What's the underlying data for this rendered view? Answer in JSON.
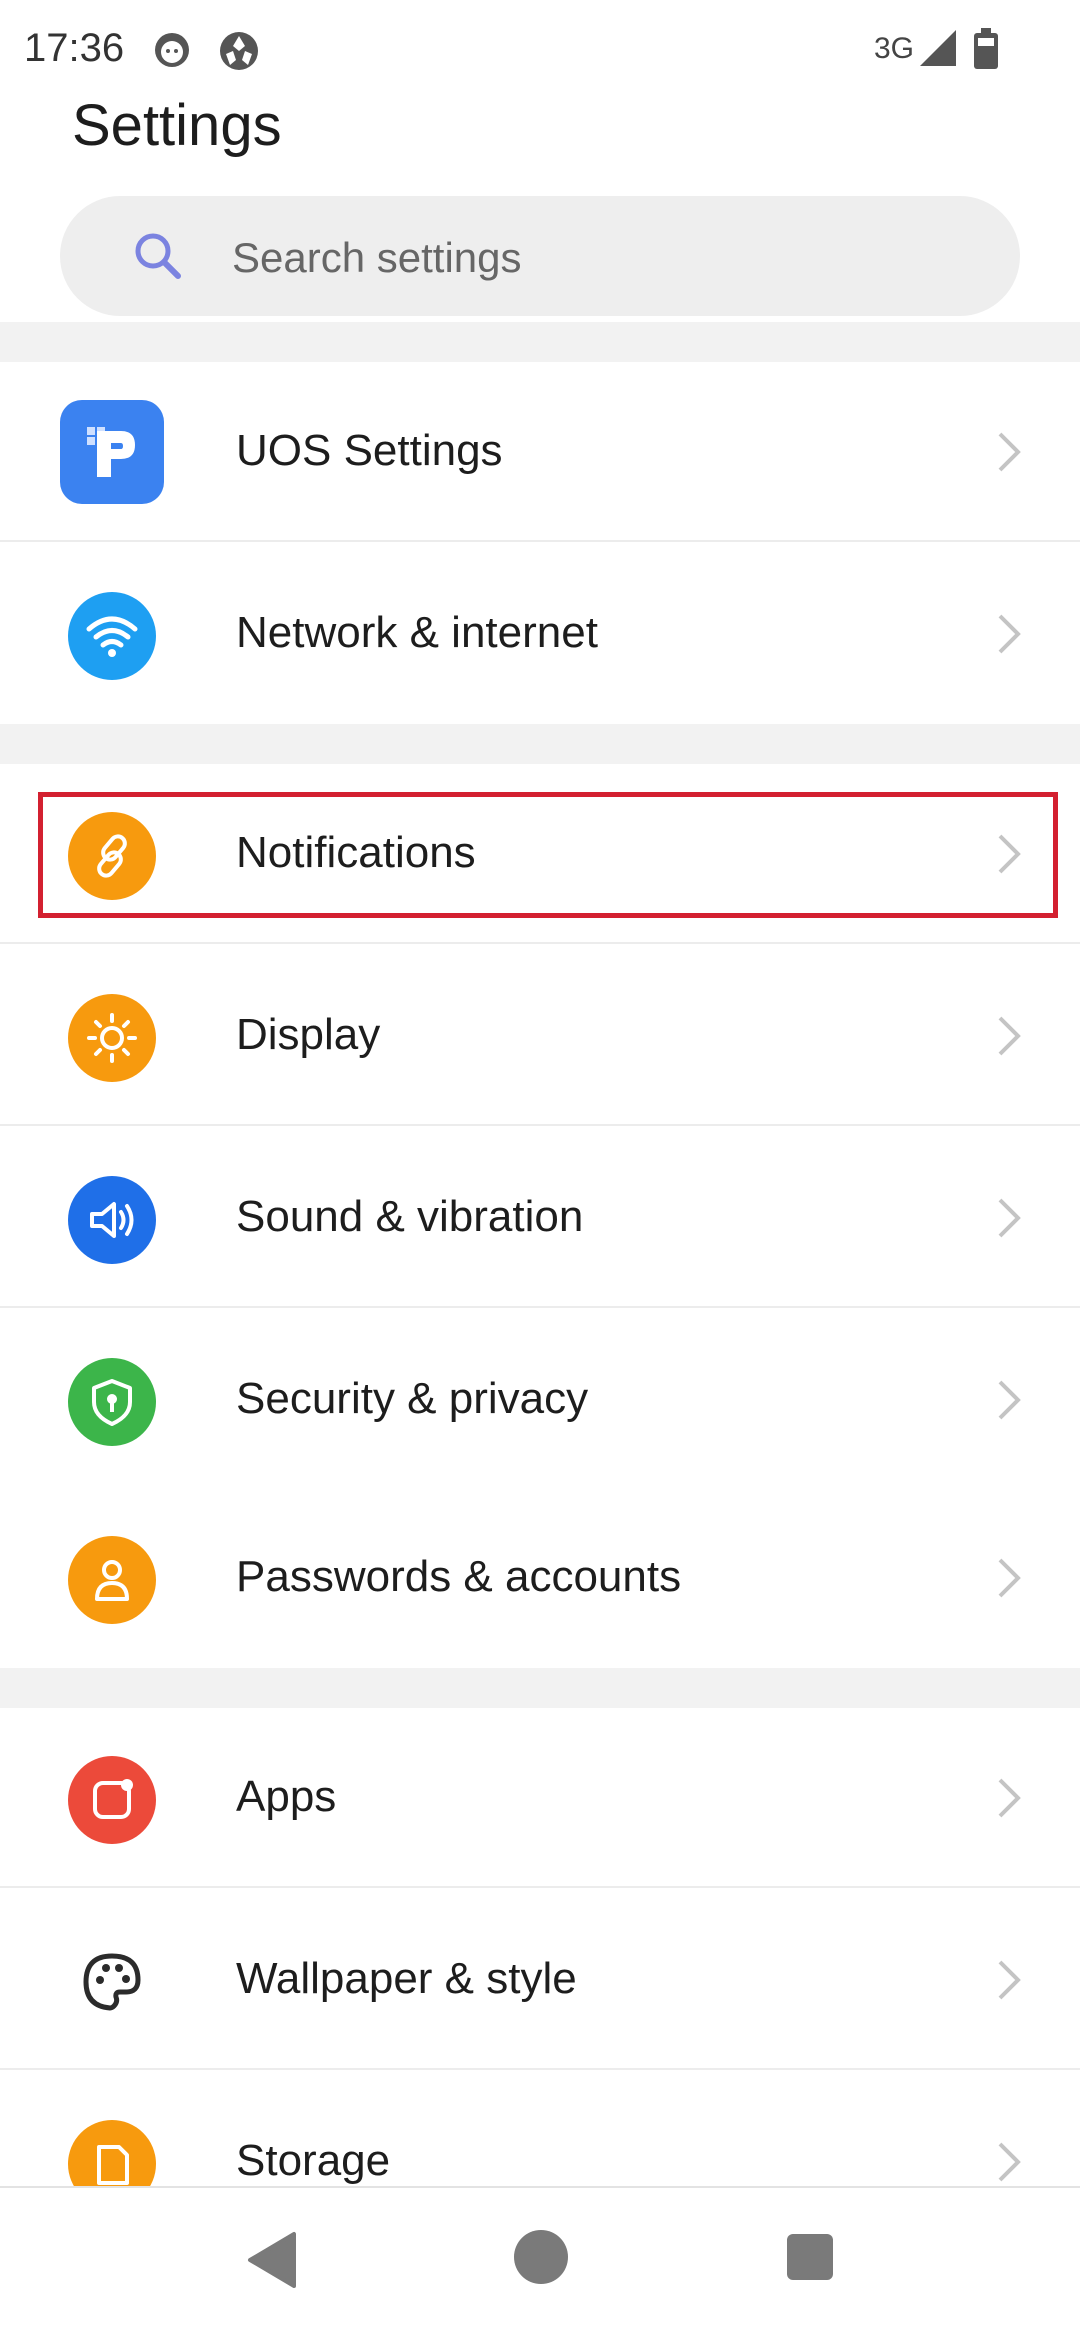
{
  "status_bar": {
    "time": "17:36",
    "network": "3G",
    "icons": [
      "face-icon",
      "ball-icon",
      "signal-icon",
      "battery-icon"
    ]
  },
  "title": "Settings",
  "search": {
    "placeholder": "Search settings"
  },
  "settings": [
    {
      "label": "UOS Settings",
      "icon": "uos-app-icon",
      "color": "#3b82f0"
    },
    {
      "label": "Network & internet",
      "icon": "wifi-icon",
      "color": "#1e9ff2"
    },
    {
      "label": "Notifications",
      "icon": "link-icon",
      "color": "#f79a0e",
      "highlighted": true
    },
    {
      "label": "Display",
      "icon": "sun-icon",
      "color": "#f79a0e"
    },
    {
      "label": "Sound & vibration",
      "icon": "speaker-icon",
      "color": "#1f6fe8"
    },
    {
      "label": "Security & privacy",
      "icon": "shield-icon",
      "color": "#3cb54a"
    },
    {
      "label": "Passwords & accounts",
      "icon": "person-icon",
      "color": "#f79a0e"
    },
    {
      "label": "Apps",
      "icon": "apps-icon",
      "color": "#ec4a3a"
    },
    {
      "label": "Wallpaper & style",
      "icon": "palette-icon",
      "color": "#2b2b2b"
    },
    {
      "label": "Storage",
      "icon": "storage-icon",
      "color": "#f79a0e"
    }
  ],
  "colors": {
    "highlight": "#d32030",
    "section_gap": "#f2f2f2",
    "nav": "#7a7a7a"
  }
}
